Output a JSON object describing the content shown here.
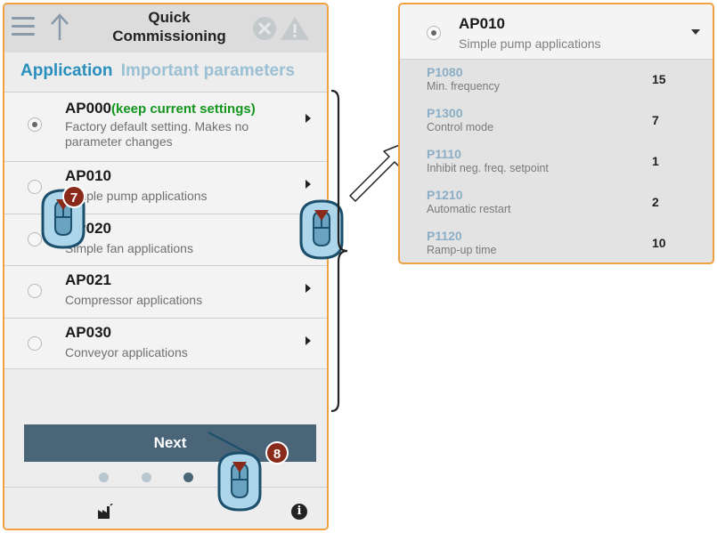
{
  "header": {
    "title_line1": "Quick",
    "title_line2": "Commissioning"
  },
  "tabs": {
    "active": "Application",
    "inactive": "Important parameters"
  },
  "applications": [
    {
      "code": "AP000",
      "note": "(keep current settings)",
      "description": "Factory default setting. Makes no parameter changes",
      "selected": true
    },
    {
      "code": "AP010",
      "note": "",
      "description": "Simple pump applications",
      "selected": false
    },
    {
      "code": "AP020",
      "note": "",
      "description": "Simple fan applications",
      "selected": false
    },
    {
      "code": "AP021",
      "note": "",
      "description": "Compressor applications",
      "selected": false
    },
    {
      "code": "AP030",
      "note": "",
      "description": "Conveyor applications",
      "selected": false
    }
  ],
  "next_label": "Next",
  "pager": {
    "total": 5,
    "current": 4
  },
  "info_glyph": "i",
  "cursors": [
    {
      "step": "7",
      "icon": "mouse-click-icon"
    },
    {
      "step": "",
      "icon": "mouse-click-icon"
    },
    {
      "step": "8",
      "icon": "mouse-click-icon"
    }
  ],
  "detail": {
    "code": "AP010",
    "description": "Simple pump applications",
    "parameters": [
      {
        "code": "P1080",
        "name": "Min. frequency",
        "value": "15"
      },
      {
        "code": "P1300",
        "name": "Control mode",
        "value": "7"
      },
      {
        "code": "P1110",
        "name": "Inhibit neg. freq. setpoint",
        "value": "1"
      },
      {
        "code": "P1210",
        "name": "Automatic restart",
        "value": "2"
      },
      {
        "code": "P1120",
        "name": "Ramp-up time",
        "value": "10"
      }
    ]
  },
  "colors": {
    "panel_border": "#f0a040",
    "tab_active": "#2a8fbd",
    "keep_note": "#14961e",
    "next_button": "#4a6478",
    "badge": "#8a2a1a",
    "cursor_fill": "#aed6ea"
  }
}
